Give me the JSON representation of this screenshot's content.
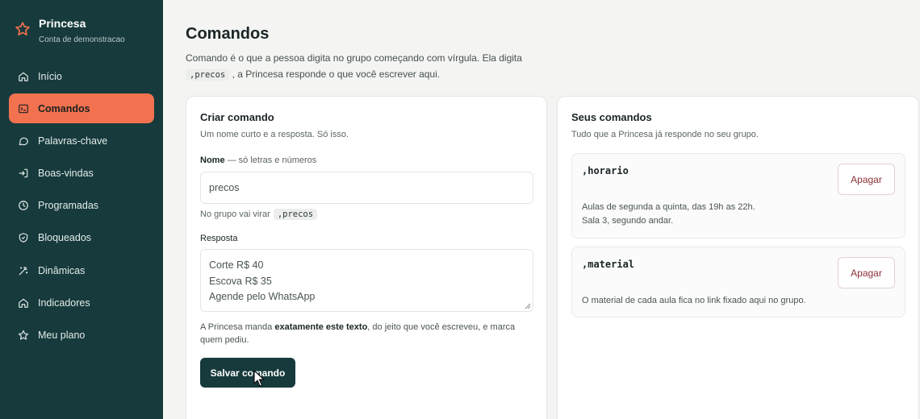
{
  "brand": {
    "name": "Princesa",
    "subtitle": "Conta de demonstracao"
  },
  "sidebar": {
    "items": [
      {
        "label": "Início",
        "icon": "home-icon"
      },
      {
        "label": "Comandos",
        "icon": "terminal-icon",
        "active": true
      },
      {
        "label": "Palavras-chave",
        "icon": "chat-bubble-icon"
      },
      {
        "label": "Boas-vindas",
        "icon": "enter-icon"
      },
      {
        "label": "Programadas",
        "icon": "clock-icon"
      },
      {
        "label": "Bloqueados",
        "icon": "shield-icon"
      },
      {
        "label": "Dinâmicas",
        "icon": "magic-wand-icon"
      },
      {
        "label": "Indicadores",
        "icon": "home-icon"
      },
      {
        "label": "Meu plano",
        "icon": "star-icon"
      }
    ]
  },
  "header": {
    "title": "Comandos",
    "desc_part1": "Comando é o que a pessoa digita no grupo começando com vírgula. Ela digita",
    "desc_code": ",precos",
    "desc_part2": ", a Princesa responde o que você escrever aqui."
  },
  "create": {
    "title": "Criar comando",
    "subtitle": "Um nome curto e a resposta. Só isso.",
    "name_label": "Nome",
    "name_hint": "— só letras e números",
    "name_value": "precos",
    "preview_prefix": "No grupo vai virar",
    "preview_code": ",precos",
    "response_label": "Resposta",
    "response_lines": [
      "Corte R$ 40",
      "Escova R$ 35",
      "Agende pelo WhatsApp"
    ],
    "note_part1": "A Princesa manda ",
    "note_bold": "exatamente este texto",
    "note_part2": ", do jeito que você escreveu, e marca quem pediu.",
    "save_label": "Salvar comando"
  },
  "list": {
    "title": "Seus comandos",
    "subtitle": "Tudo que a Princesa já responde no seu grupo.",
    "delete_label": "Apagar",
    "commands": [
      {
        "name": ",horario",
        "response_lines": [
          "Aulas de segunda a quinta, das 19h as 22h.",
          "Sala 3, segundo andar."
        ]
      },
      {
        "name": ",material",
        "response_lines": [
          "O material de cada aula fica no link fixado aqui no grupo."
        ]
      }
    ]
  },
  "colors": {
    "sidebar": "#173a3c",
    "accent": "#f2724f",
    "danger": "#8a2f36"
  }
}
